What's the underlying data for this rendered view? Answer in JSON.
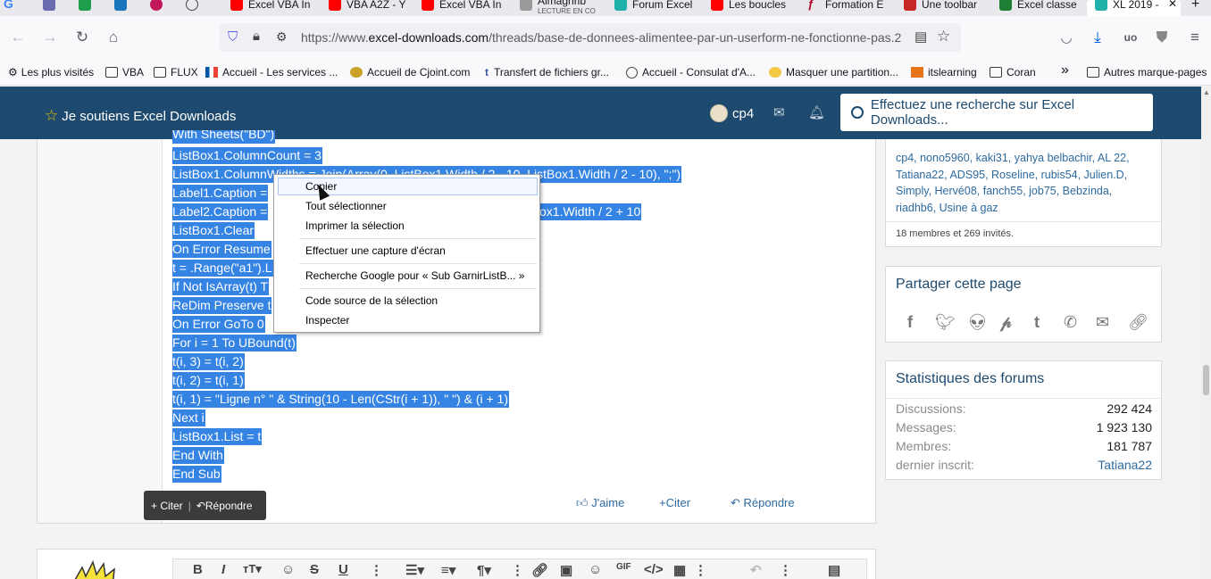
{
  "browser": {
    "tabs": [
      {
        "label": "G",
        "color": "#4285f4"
      },
      {
        "label": "",
        "color": "#6b6bb0"
      },
      {
        "label": "",
        "color": "#1e9e4a"
      },
      {
        "label": "",
        "color": "#1b75bb"
      },
      {
        "label": "",
        "color": "#c2185b"
      },
      {
        "label": "",
        "color": "#777"
      },
      {
        "label": "Excel VBA In",
        "color": "#ff0000"
      },
      {
        "label": "VBA A2Z - Y",
        "color": "#ff0000"
      },
      {
        "label": "Excel VBA In",
        "color": "#ff0000"
      },
      {
        "label": "Almaghrib",
        "sub": "LECTURE EN CO",
        "color": "#999"
      },
      {
        "label": "Forum Excel",
        "color": "#20b2aa"
      },
      {
        "label": "Les boucles",
        "color": "#ff0000"
      },
      {
        "label": "Formation E",
        "color": "#b00020"
      },
      {
        "label": "Une toolbar",
        "color": "#c62828"
      },
      {
        "label": "Excel classe",
        "color": "#1e7e34"
      },
      {
        "label": "XL 2019 -",
        "color": "#20b2aa"
      }
    ],
    "tab_close": "✕",
    "new_tab": "+",
    "url_prefix": "https://www.",
    "url_domain": "excel-downloads.com",
    "url_path": "/threads/base-de-donnees-alimentee-par-un-userform-ne-fonctionne-pas.2",
    "bookmarks": [
      "Les plus visités",
      "VBA",
      "FLUX",
      "Accueil - Les services ...",
      "Accueil de Cjoint.com",
      "Transfert de fichiers gr...",
      "Accueil - Consulat d'A...",
      "Masquer une partition...",
      "itslearning",
      "Coran",
      "Autres marque-pages"
    ],
    "overflow": "»"
  },
  "header": {
    "support_label": "Je soutiens Excel Downloads",
    "username": "cp4",
    "search_placeholder": "Effectuez une recherche sur Excel Downloads..."
  },
  "post": {
    "code_lines": [
      "With Sheets(\"BD\")",
      "ListBox1.ColumnCount = 3",
      "ListBox1.ColumnWidths = Join(Array(0, ListBox1.Width / 2 - 10, ListBox1.Width / 2 - 10), \";\")",
      "Label1.Caption = ",
      "Label2.Caption = ",
      "ListBox1.Clear",
      "On Error Resume ",
      "t = .Range(\"a1\").L",
      "If Not IsArray(t) T",
      "ReDim Preserve t",
      "On Error GoTo 0",
      "For i = 1 To UBound(t)",
      "t(i, 3) = t(i, 2)",
      "t(i, 2) = t(i, 1)",
      "t(i, 1) = \"Ligne n° \" & String(10 - Len(CStr(i + 1)), \" \") & (i + 1)",
      "Next i",
      "ListBox1.List = t",
      "End With",
      "End Sub"
    ],
    "label2_tail": "ox1.Width / 2 + 10",
    "actions": {
      "like": "J'aime",
      "quote": "Citer",
      "reply": "Répondre"
    }
  },
  "quotebar": {
    "quote": "+ Citer",
    "sep": "|",
    "reply": "Répondre"
  },
  "context_menu": {
    "items": [
      "Copier",
      "Tout sélectionner",
      "Imprimer la sélection",
      "Effectuer une capture d'écran",
      "Recherche Google pour « Sub GarnirListB... »",
      "Code source de la sélection",
      "Inspecter"
    ]
  },
  "sidebar": {
    "members_online": "cp4, nono5960, kaki31, yahya belbachir, AL 22, Tatiana22, ADS95, Roseline, rubis54, Julien.D, Simply, Hervé08, fanch55, job75, Bebzinda, riadhb6, Usine à gaz",
    "members_count": "18 membres et 269 invités.",
    "share_title": "Partager cette page",
    "share_icons": [
      "facebook-icon",
      "twitter-icon",
      "reddit-icon",
      "pinterest-icon",
      "tumblr-icon",
      "whatsapp-icon",
      "email-icon",
      "link-icon"
    ],
    "stats_title": "Statistiques des forums",
    "stats": [
      {
        "label": "Discussions:",
        "value": "292 424"
      },
      {
        "label": "Messages:",
        "value": "1 923 130"
      },
      {
        "label": "Membres:",
        "value": "181 787"
      },
      {
        "label": "dernier inscrit:",
        "value": "Tatiana22"
      }
    ]
  }
}
